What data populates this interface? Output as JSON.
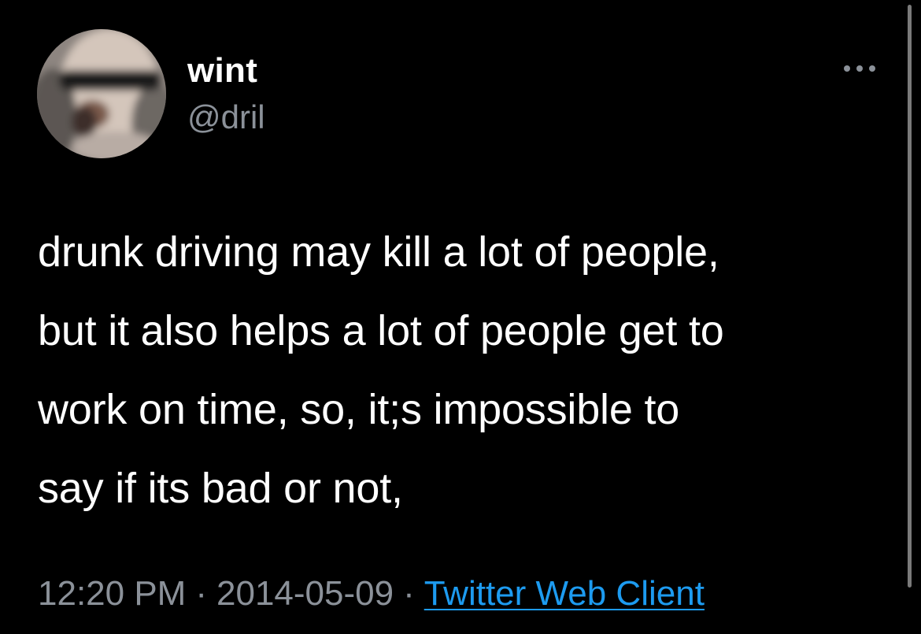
{
  "user": {
    "display_name": "wint",
    "handle": "@dril"
  },
  "tweet": {
    "text": "drunk driving may kill a lot of people,\nbut it also helps a lot of people get to\nwork on time, so, it;s impossible to\nsay if its bad or not,",
    "time": "12:20 PM",
    "date": "2014-05-09",
    "separator": "·",
    "client": "Twitter Web Client"
  },
  "icons": {
    "more": "more-horizontal-icon",
    "avatar": "avatar"
  },
  "colors": {
    "background": "#000000",
    "text": "#ffffff",
    "secondary": "#8b9199",
    "link": "#1d9bf0"
  }
}
